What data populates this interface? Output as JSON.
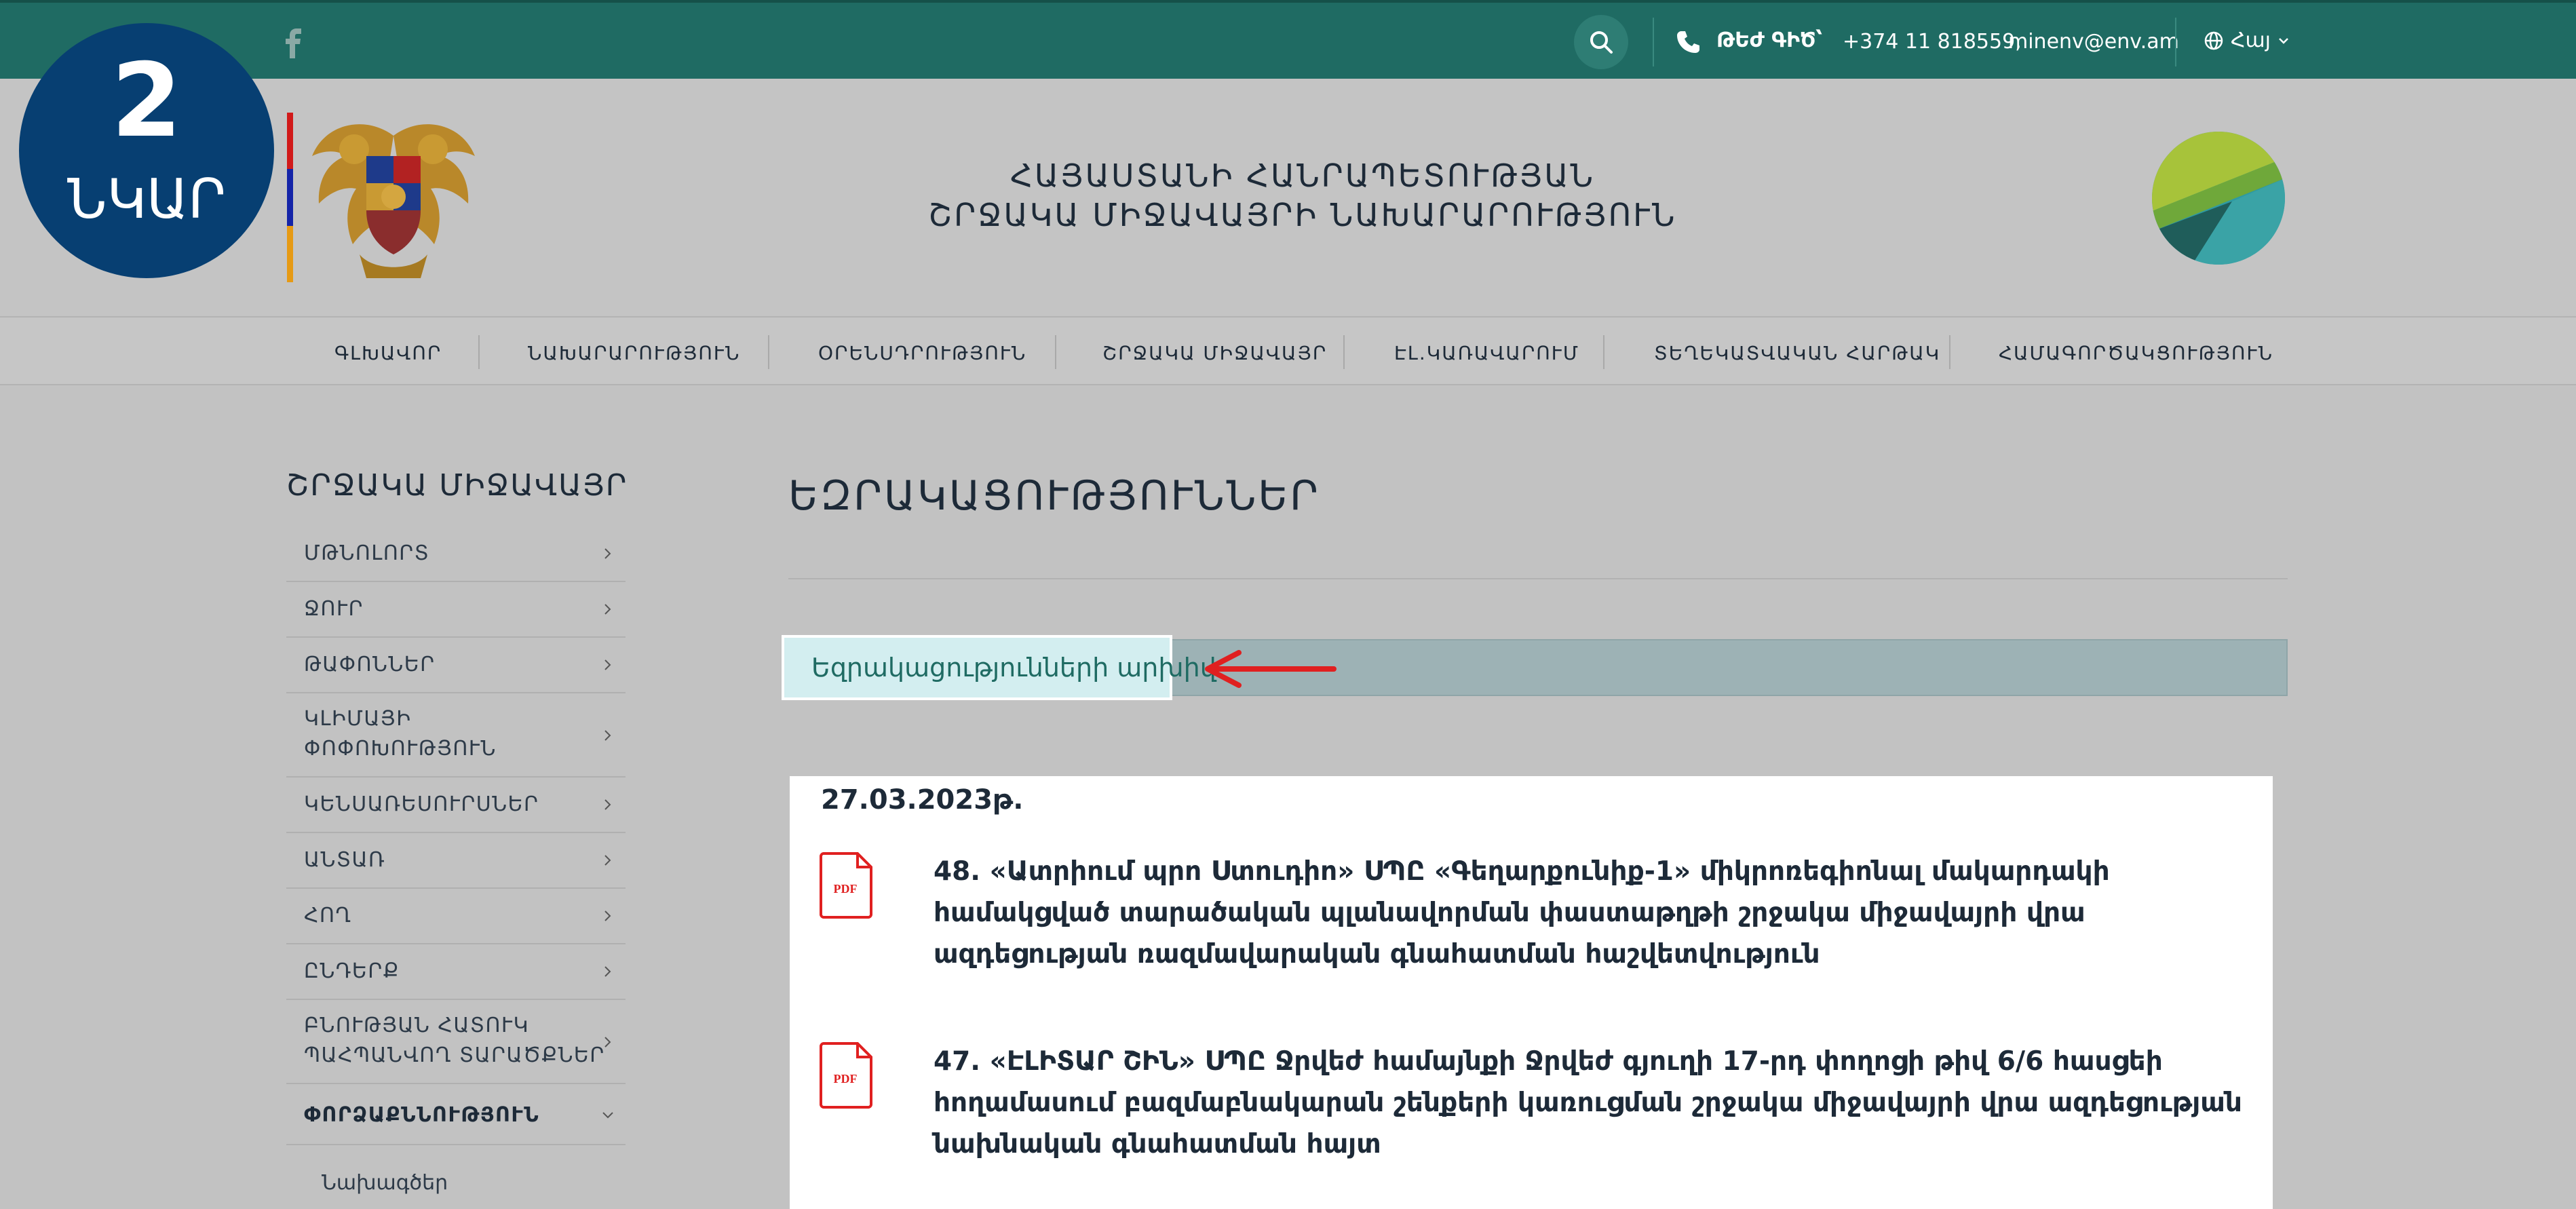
{
  "topbar": {
    "social": "facebook",
    "hotline_label": "ԹԵԺ ԳԻԾ՝",
    "phone": "+374 11 818559,",
    "email": "minenv@env.am",
    "language": "Հայ"
  },
  "badge": {
    "number": "2",
    "label": "ՆԿԱՐ"
  },
  "header": {
    "title_line1": "ՀԱՅԱՍՏԱՆԻ ՀԱՆՐԱՊԵՏՈՒԹՅԱՆ",
    "title_line2": "ՇՐՋԱԿԱ ՄԻՋԱՎԱՅՐԻ ՆԱԽԱՐԱՐՈՒԹՅՈՒՆ"
  },
  "nav": {
    "items": [
      "ԳԼԽԱՎՈՐ",
      "ՆԱԽԱՐԱՐՈՒԹՅՈՒՆ",
      "ՕՐԵՆՍԴՐՈՒԹՅՈՒՆ",
      "ՇՐՋԱԿԱ ՄԻՋԱՎԱՅՐ",
      "ԷԼ.ԿԱՌԱՎԱՐՈՒՄ",
      "ՏԵՂԵԿԱՏՎԱԿԱՆ ՀԱՐԹԱԿ",
      "ՀԱՄԱԳՈՐԾԱԿՑՈՒԹՅՈՒՆ"
    ]
  },
  "sidebar": {
    "title": "ՇՐՋԱԿԱ ՄԻՋԱՎԱՅՐ",
    "items": [
      {
        "line1": "ՄԹՆՈԼՈՐՏ",
        "line2": ""
      },
      {
        "line1": "ՋՈՒՐ",
        "line2": ""
      },
      {
        "line1": "ԹԱՓՈՆՆԵՐ",
        "line2": ""
      },
      {
        "line1": "ԿԼԻՄԱՅԻ",
        "line2": "ՓՈՓՈԽՈՒԹՅՈՒՆ"
      },
      {
        "line1": "ԿԵՆՍԱՌԵՍՈՒՐՍՆԵՐ",
        "line2": ""
      },
      {
        "line1": "ԱՆՏԱՌ",
        "line2": ""
      },
      {
        "line1": "ՀՈՂ",
        "line2": ""
      },
      {
        "line1": "ԸՆԴԵՐՔ",
        "line2": ""
      },
      {
        "line1": "ԲՆՈՒԹՅԱՆ ՀԱՏՈՒԿ",
        "line2": "ՊԱՀՊԱՆՎՈՂ ՏԱՐԱԾՔՆԵՐ"
      },
      {
        "line1": "ՓՈՐՁԱՔՆՆՈՒԹՅՈՒՆ",
        "line2": ""
      }
    ],
    "subitem": "Նախագծեր"
  },
  "main": {
    "title": "ԵԶՐԱԿԱՑՈՒԹՅՈՒՆՆԵՐ",
    "archive_label": "Եզրակացությունների արխիվ",
    "date": "27.03.2023թ.",
    "documents": [
      {
        "number": "48.",
        "text": "«Ատրիում պրո Ստուդիո» ՍՊԸ «Գեղարքունիք-1» միկրոռեգիոնալ մակարդակի համակցված տարածական պլանավորման փաստաթղթի շրջակա միջավայրի վրա ազդեցության ռազմավարական գնահատման հաշվետվություն"
      },
      {
        "number": "47.",
        "text": "«ԷԼԻՏԱՐ ՇԻՆ» ՍՊԸ Ջրվեժ համայնքի Ջրվեժ գյուղի 17-րդ փողոցի թիվ 6/6 հասցեի հողամասում բազմաբնակարան շենքերի կառուցման շրջակա միջավայրի վրա ազդեցության նախնական գնահատման հայտ"
      }
    ]
  },
  "colors": {
    "topbar": "#1f6b63",
    "badge": "#073f72",
    "archive_button": "#d3eef0",
    "arrow": "#e02020",
    "pdf": "#e02020"
  },
  "icons": [
    "facebook-icon",
    "search-icon",
    "phone-icon",
    "globe-icon",
    "chevron-down-icon",
    "chevron-right-icon",
    "pdf-icon",
    "arrow-left-icon"
  ]
}
